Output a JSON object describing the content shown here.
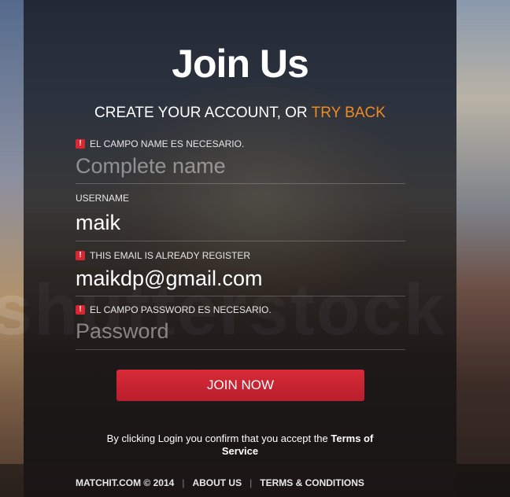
{
  "page": {
    "title": "Join Us",
    "subtitle_prefix": "CREATE YOUR ACCOUNT, OR ",
    "subtitle_link": "TRY BACK"
  },
  "watermark_text": "shutterstock",
  "form": {
    "name": {
      "error": "EL CAMPO NAME ES NECESARIO.",
      "placeholder": "Complete name",
      "value": ""
    },
    "username": {
      "label": "USERNAME",
      "value": "maik"
    },
    "email": {
      "error": "THIS EMAIL IS ALREADY REGISTER",
      "value": "maikdp@gmail.com"
    },
    "password": {
      "error": "EL CAMPO PASSWORD ES NECESARIO.",
      "placeholder": "Password",
      "value": ""
    },
    "error_icon": "!",
    "submit_label": "JOIN NOW"
  },
  "legal": {
    "text": "By clicking Login you confirm that you accept the ",
    "link_part1": "Terms of",
    "link_part2": "Service"
  },
  "footer": {
    "brand": "MATCHIT.COM © 2014",
    "about": "ABOUT US",
    "terms": "TERMS & CONDITIONS",
    "separator": "|"
  },
  "colors": {
    "accent_orange": "#f08a24",
    "button_red": "#c9232f",
    "error_red": "#d92631"
  }
}
